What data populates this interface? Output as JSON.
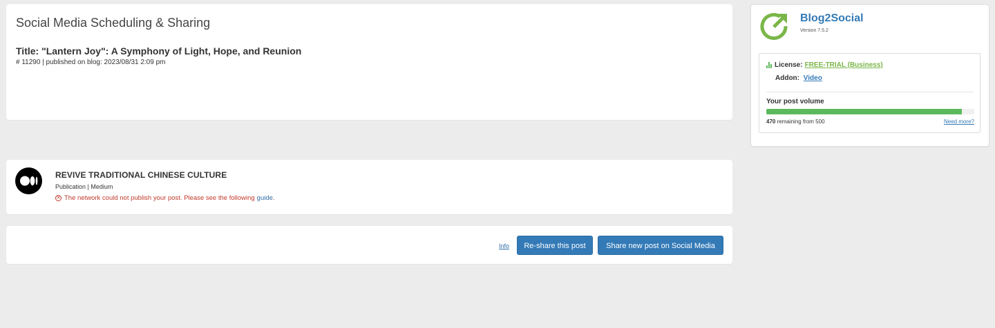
{
  "header": {
    "page_title": "Social Media Scheduling & Sharing",
    "post_title": "Title: \"Lantern Joy\": A Symphony of Light, Hope, and Reunion",
    "post_meta": "# 11290 | published on blog: 2023/08/31 2:09 pm"
  },
  "network": {
    "logo_icon": "medium-logo-icon",
    "name": "REVIVE TRADITIONAL CHINESE CULTURE",
    "type": "Publication | Medium",
    "error_icon": "error-circle-icon",
    "error_text": "The network could not publish your post. Please see the following",
    "error_link": "guide",
    "error_suffix": "."
  },
  "actions": {
    "info_label": "Info",
    "reshare_label": "Re-share this post",
    "share_new_label": "Share new post on Social Media"
  },
  "sidebar": {
    "logo_icon": "blog2social-logo-icon",
    "app_name": "Blog2Social",
    "version": "Version 7.5.2",
    "license_label": "License:",
    "license_value": "FREE-TRIAL (Business)",
    "addon_label": "Addon:",
    "addon_value": "Video",
    "volume_label": "Your post volume",
    "volume_remaining": "470",
    "volume_remaining_text": "remaining from 500",
    "volume_progress_fraction": 0.94,
    "need_more": "Need more?"
  },
  "colors": {
    "accent": "#337ab7",
    "success": "#5cb85c",
    "license_green": "#7ab648",
    "error": "#c0392b",
    "background": "#ececec"
  }
}
